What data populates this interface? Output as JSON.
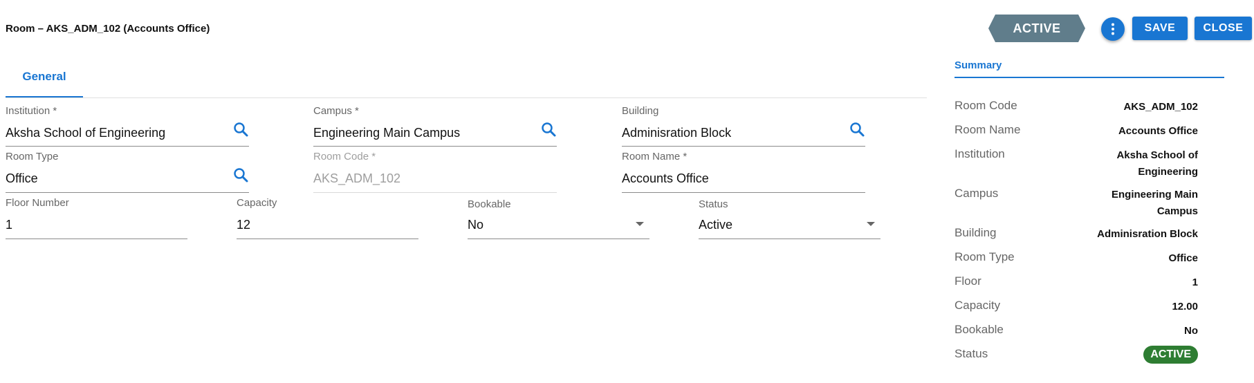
{
  "header": {
    "title": "Room – AKS_ADM_102 (Accounts Office)",
    "status_ribbon": "ACTIVE",
    "more_icon": "more-vertical-icon",
    "save_label": "SAVE",
    "close_label": "CLOSE"
  },
  "tabs": [
    {
      "label": "General"
    }
  ],
  "form": {
    "institution": {
      "label": "Institution *",
      "value": "Aksha School of Engineering"
    },
    "campus": {
      "label": "Campus *",
      "value": "Engineering Main Campus"
    },
    "building": {
      "label": "Building",
      "value": "Adminisration Block"
    },
    "room_type": {
      "label": "Room Type",
      "value": "Office"
    },
    "room_code": {
      "label": "Room Code *",
      "value": "AKS_ADM_102"
    },
    "room_name": {
      "label": "Room Name *",
      "value": "Accounts Office"
    },
    "floor_number": {
      "label": "Floor Number",
      "value": "1"
    },
    "capacity": {
      "label": "Capacity",
      "value": "12"
    },
    "bookable": {
      "label": "Bookable",
      "value": "No"
    },
    "status": {
      "label": "Status",
      "value": "Active"
    }
  },
  "summary": {
    "title": "Summary",
    "rows": [
      {
        "key": "Room Code",
        "value": "AKS_ADM_102"
      },
      {
        "key": "Room Name",
        "value": "Accounts Office"
      },
      {
        "key": "Institution",
        "value": "Aksha School of Engineering"
      },
      {
        "key": "Campus",
        "value": "Engineering Main Campus"
      },
      {
        "key": "Building",
        "value": "Adminisration Block"
      },
      {
        "key": "Room Type",
        "value": "Office"
      },
      {
        "key": "Floor",
        "value": "1"
      },
      {
        "key": "Capacity",
        "value": "12.00"
      },
      {
        "key": "Bookable",
        "value": "No"
      },
      {
        "key": "Status",
        "value": "ACTIVE"
      }
    ]
  },
  "colors": {
    "primary": "#1976d2",
    "ribbon": "#607d8b",
    "active_badge": "#2e7d32"
  }
}
